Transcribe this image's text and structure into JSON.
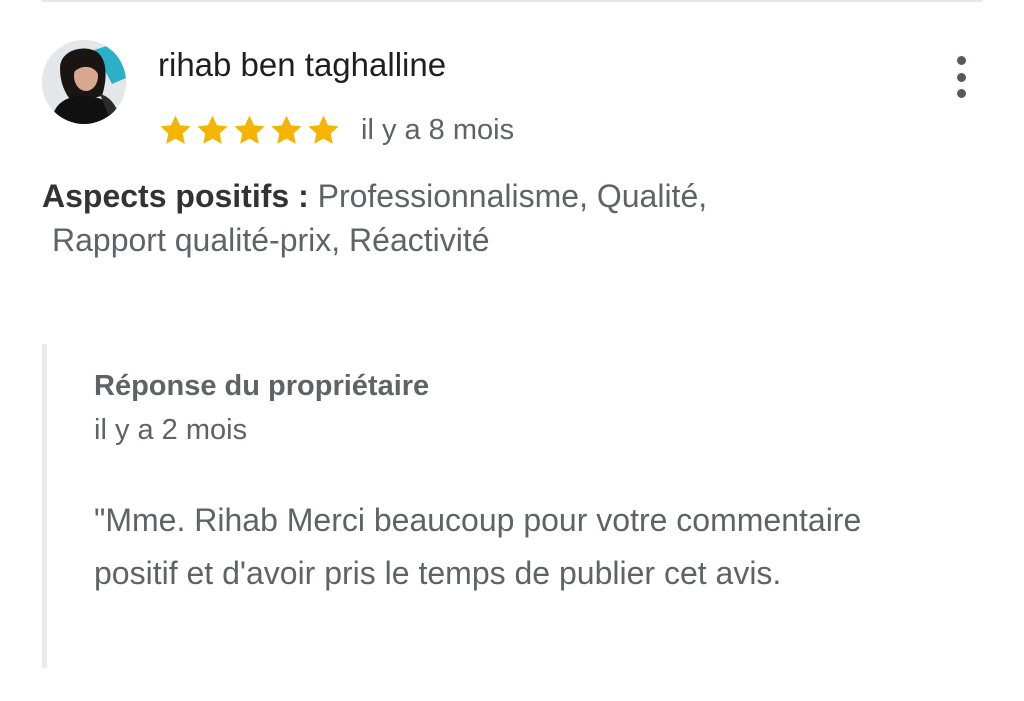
{
  "review": {
    "reviewer_name": "rihab ben taghalline",
    "avatar_icon": "reviewer-avatar",
    "menu_icon": "more-vert-icon",
    "rating": 5,
    "max_rating": 5,
    "star_icon": "star-icon",
    "star_color": "#f4b400",
    "time": "il y a 8 mois",
    "aspects_label": "Aspects positifs :",
    "aspects_line1": " Professionnalisme, Qualité,",
    "aspects_line2": "Rapport qualité-prix, Réactivité"
  },
  "owner_reply": {
    "title": "Réponse du propriétaire",
    "time": "il y a 2 mois",
    "text": "\"Mme. Rihab Merci beaucoup pour votre commentaire positif et d'avoir pris le temps de publier cet avis."
  }
}
